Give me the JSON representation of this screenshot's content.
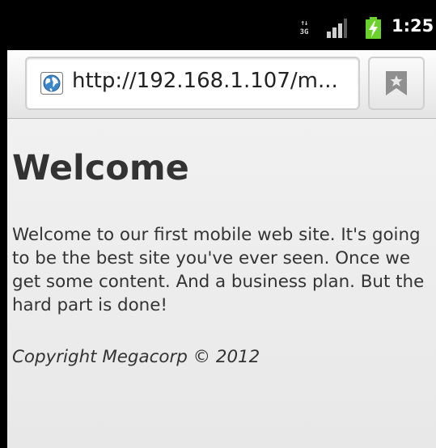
{
  "status_bar": {
    "network_type": "3G",
    "network_icon": "data-3g-icon",
    "signal_icon": "signal-strength-icon",
    "battery_icon": "battery-charging-icon",
    "clock": "1:25"
  },
  "browser": {
    "url": "http://192.168.1.107/m...",
    "site_icon": "globe-icon",
    "bookmark_icon": "bookmark-icon"
  },
  "page": {
    "heading": "Welcome",
    "body": "Welcome to our first mobile web site. It's going to be the best site you've ever seen. Once we get some content. And a business plan. But the hard part is done!",
    "copyright": "Copyright Megacorp © 2012"
  },
  "colors": {
    "status_bar_bg": "#000000",
    "battery_green": "#6bd12b",
    "page_text": "#333333",
    "page_bg": "#eeeeee"
  }
}
